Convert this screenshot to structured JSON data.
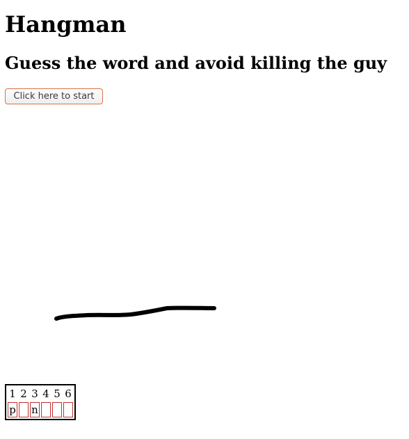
{
  "page": {
    "title": "Hangman",
    "subtitle": "Guess the word and avoid killing the guy"
  },
  "start_button": {
    "label": "Click here to start"
  },
  "word": {
    "positions": [
      "1",
      "2",
      "3",
      "4",
      "5",
      "6"
    ],
    "letters": [
      "p",
      "",
      "n",
      "",
      "",
      ""
    ]
  },
  "colors": {
    "button_border": "#e0704a",
    "letter_box_border": "#c03030"
  }
}
